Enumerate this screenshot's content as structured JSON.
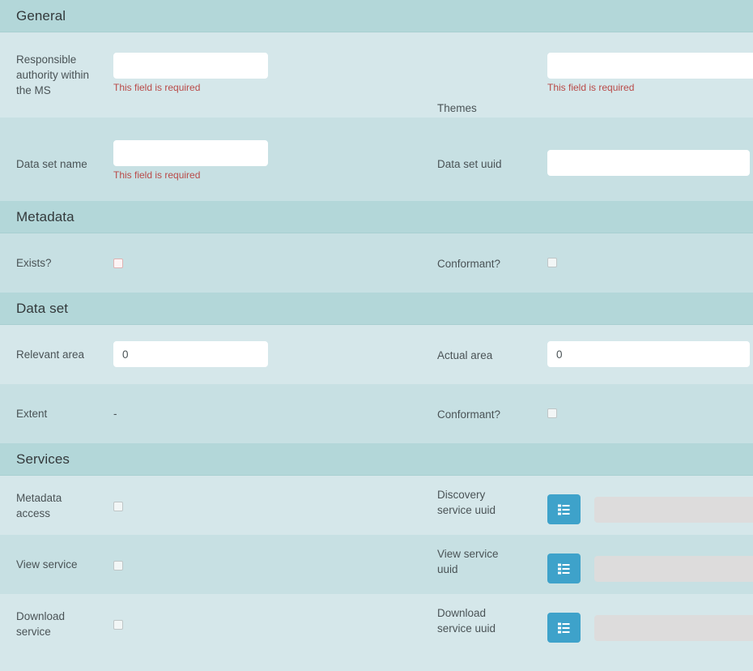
{
  "sections": [
    {
      "id": "general",
      "title": "General",
      "rows": [
        {
          "left_label": "Responsible authority within the MS",
          "left_input_value": "",
          "left_input_placeholder": "",
          "left_error": "This field is required",
          "right_label": "Themes",
          "right_input_value": "",
          "right_input_placeholder": "",
          "right_error": "This field is required"
        },
        {
          "left_label": "Data set name",
          "left_input_value": "",
          "left_input_placeholder": "",
          "left_error": "This field is required",
          "right_label": "Data set uuid",
          "right_input_value": "",
          "right_input_placeholder": "",
          "right_error": ""
        }
      ]
    },
    {
      "id": "metadata",
      "title": "Metadata",
      "rows": [
        {
          "left_label": "Exists?",
          "right_label": "Conformant?"
        }
      ]
    },
    {
      "id": "dataset",
      "title": "Data set",
      "rows": [
        {
          "left_label": "Relevant area",
          "left_input_value": "0",
          "right_label": "Actual area",
          "right_input_value": "0"
        },
        {
          "left_label": "Extent",
          "left_value": "-",
          "right_label": "Conformant?"
        }
      ]
    },
    {
      "id": "services",
      "title": "Services",
      "rows": [
        {
          "left_label": "Metadata access",
          "right_label": "Discovery service uuid",
          "right_input_value": "",
          "button_icon": "list-icon"
        },
        {
          "left_label": "View service",
          "right_label": "View service uuid",
          "right_input_value": "",
          "button_icon": "list-icon"
        },
        {
          "left_label": "Download service",
          "right_label": "Download service uuid",
          "right_input_value": "",
          "button_icon": "list-icon"
        }
      ]
    }
  ],
  "colors": {
    "section_header_bg": "#b3d7d9",
    "row_bg_light": "#d5e7ea",
    "row_bg_dark": "#c7e0e3",
    "error_text": "#b94a48",
    "button_blue": "#3ea2ca",
    "disabled_input": "#dddcdc"
  }
}
